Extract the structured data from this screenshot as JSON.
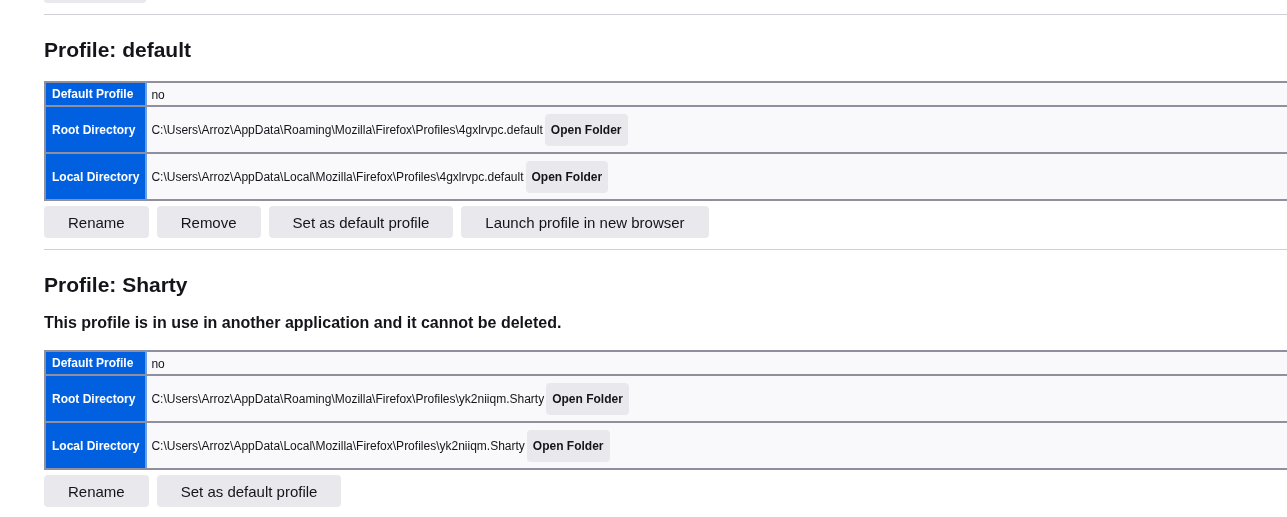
{
  "profiles": [
    {
      "title": "Profile: default",
      "rows": [
        {
          "label": "Default Profile",
          "value": "no"
        },
        {
          "label": "Root Directory",
          "value": "C:\\Users\\Arroz\\AppData\\Roaming\\Mozilla\\Firefox\\Profiles\\4gxlrvpc.default",
          "button": "Open Folder"
        },
        {
          "label": "Local Directory",
          "value": "C:\\Users\\Arroz\\AppData\\Local\\Mozilla\\Firefox\\Profiles\\4gxlrvpc.default",
          "button": "Open Folder"
        }
      ],
      "buttons": [
        "Rename",
        "Remove",
        "Set as default profile",
        "Launch profile in new browser"
      ]
    },
    {
      "title": "Profile: Sharty",
      "message": "This profile is in use in another application and it cannot be deleted.",
      "rows": [
        {
          "label": "Default Profile",
          "value": "no"
        },
        {
          "label": "Root Directory",
          "value": "C:\\Users\\Arroz\\AppData\\Roaming\\Mozilla\\Firefox\\Profiles\\yk2niiqm.Sharty",
          "button": "Open Folder"
        },
        {
          "label": "Local Directory",
          "value": "C:\\Users\\Arroz\\AppData\\Local\\Mozilla\\Firefox\\Profiles\\yk2niiqm.Sharty",
          "button": "Open Folder"
        }
      ],
      "buttons": [
        "Rename",
        "Set as default profile"
      ]
    }
  ]
}
